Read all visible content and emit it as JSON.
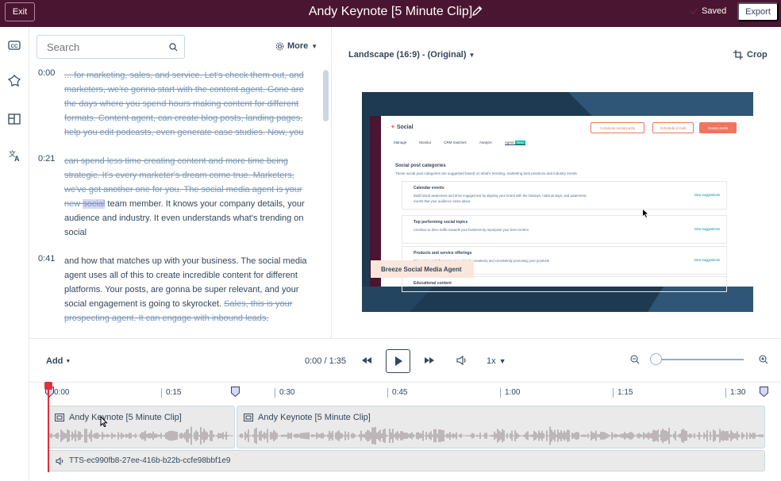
{
  "topbar": {
    "exit_label": "Exit",
    "title": "Andy Keynote [5 Minute Clip]",
    "saved_label": "Saved",
    "export_label": "Export"
  },
  "rail": {
    "icons": [
      "closed-captions-icon",
      "sparkle-flower-icon",
      "layout-panels-icon",
      "translate-icon"
    ]
  },
  "transcript": {
    "search_placeholder": "Search",
    "more_label": "More",
    "segments": [
      {
        "time": "0:00",
        "struck": "... for marketing, sales, and service. Let's check them out, and marketers, we're gonna start with the content agent. Gone are the days where you spend hours making content for different formats. Content agent, can create blog posts, landing pages, help you edit podcasts, even generate case studies. Now, you",
        "kept": ""
      },
      {
        "time": "0:21",
        "struck": "can spend less time creating content and more time being strategic. It's every marketer's dream come true. Marketers, we've got another one for you. The social media agent is your new ",
        "highlight": "social",
        "kept": " team member. It knows your company details, your audience and industry. It even understands what's trending on social"
      },
      {
        "time": "0:41",
        "kept": "and how that matches up with your business. The social media agent uses all of this to create incredible content for different platforms. Your posts, are gonna be super relevant, and your social engagement is going to skyrocket. ",
        "struck": "Sales, this is your prospecting agent. It can engage with inbound leads,"
      }
    ]
  },
  "preview": {
    "aspect_label": "Landscape (16:9) - (Original)",
    "crop_label": "Crop",
    "video": {
      "app_title": "Social",
      "buttons": [
        "Compose social posts",
        "Schedule in bulk",
        "Create posts"
      ],
      "tabs": [
        "Manage",
        "Monitor",
        "CRM matches",
        "Analyze",
        "Agent",
        "New"
      ],
      "section_title": "Social post categories",
      "section_sub": "These social post categories are suggested based on what's trending, marketing best practices and industry trends.",
      "cards": [
        {
          "title": "Calendar events",
          "desc": "Build brand awareness and drive engagement by aligning your brand with the holidays, national days, and awareness events that your audience cares about.",
          "link": "View suggestions"
        },
        {
          "title": "Top performing social topics",
          "desc": "Continue to drive traffic towards your business by repurpose your best content.",
          "link": "View suggestions"
        },
        {
          "title": "Products and service offerings",
          "desc": "Drive sales and showcase your value by creatively and consistently promoting your products",
          "link": "View suggestions"
        },
        {
          "title": "Educational content",
          "desc": "",
          "link": ""
        }
      ],
      "caption": "Breeze Social Media Agent"
    }
  },
  "controls": {
    "add_label": "Add",
    "timecode": "0:00 / 1:35",
    "speed": "1x"
  },
  "timeline": {
    "ticks": [
      "0:00",
      "0:15",
      "0:30",
      "0:45",
      "1:00",
      "1:15",
      "1:30"
    ],
    "clips": [
      {
        "label": "Andy Keynote [5 Minute Clip]"
      },
      {
        "label": "Andy Keynote [5 Minute Clip]"
      }
    ],
    "tts_label": "TTS-ec990fb8-27ee-416b-b22b-ccfe98bbf1e9"
  },
  "colors": {
    "topbar": "#4a1530",
    "accent": "#f2745e",
    "playhead": "#e0313b",
    "text": "#33475b"
  }
}
